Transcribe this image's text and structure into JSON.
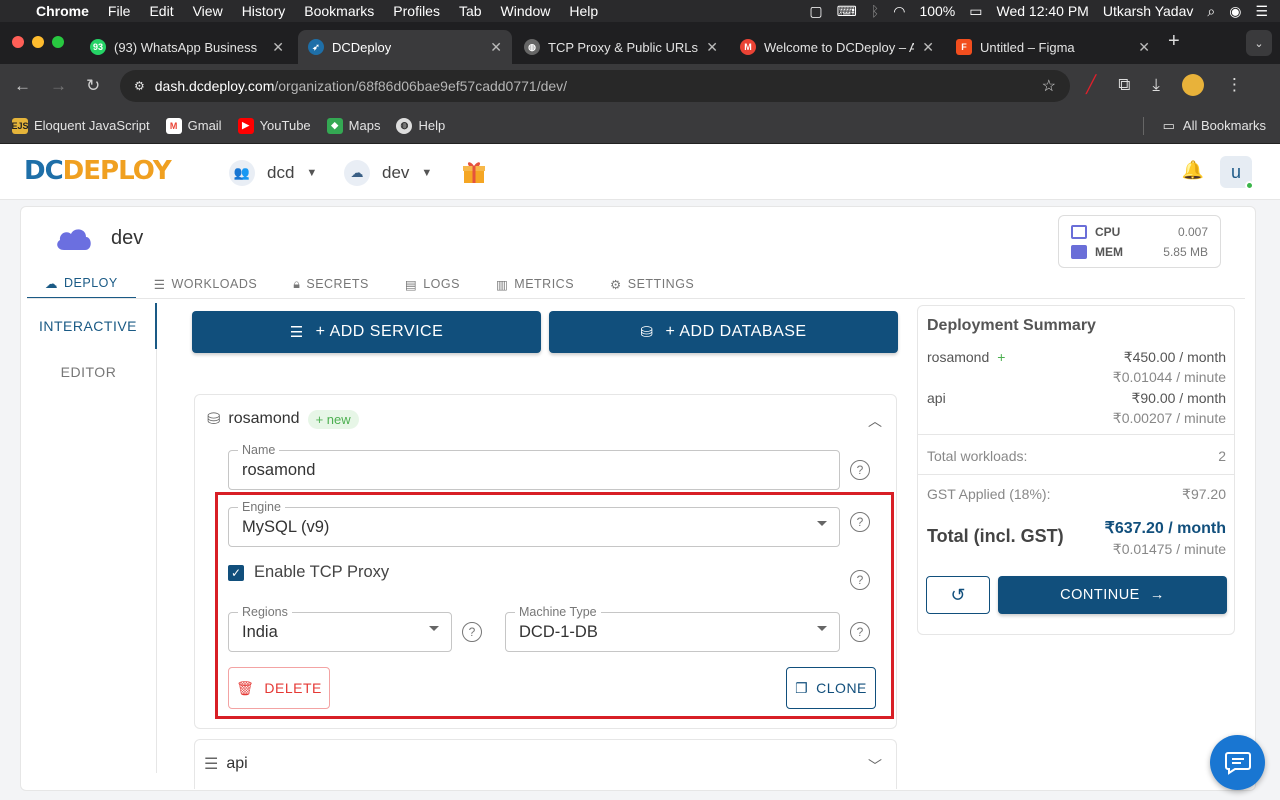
{
  "menubar": {
    "app": "Chrome",
    "items": [
      "File",
      "Edit",
      "View",
      "History",
      "Bookmarks",
      "Profiles",
      "Tab",
      "Window",
      "Help"
    ],
    "battery": "100%",
    "datetime": "Wed 12:40 PM",
    "user": "Utkarsh Yadav"
  },
  "tabs": [
    {
      "title": "(93) WhatsApp Business",
      "icon": "whatsapp-icon"
    },
    {
      "title": "DCDeploy",
      "icon": "rocket-icon"
    },
    {
      "title": "TCP Proxy & Public URLs",
      "icon": "globe-icon"
    },
    {
      "title": "Welcome to DCDeploy – A",
      "icon": "gmail-icon"
    },
    {
      "title": "Untitled – Figma",
      "icon": "figma-icon"
    }
  ],
  "address": {
    "domain": "dash.dcdeploy.com",
    "path": "/organization/68f86d06bae9ef57cadd0771/dev/"
  },
  "bookmarks": {
    "items": [
      {
        "label": "Eloquent JavaScript",
        "icon": "ejs-icon"
      },
      {
        "label": "Gmail",
        "icon": "gmail-icon"
      },
      {
        "label": "YouTube",
        "icon": "youtube-icon"
      },
      {
        "label": "Maps",
        "icon": "maps-icon"
      },
      {
        "label": "Help",
        "icon": "globe-icon"
      }
    ],
    "all": "All Bookmarks"
  },
  "header": {
    "logo_dc": "DC",
    "logo_deploy": "DEPLOY",
    "org": "dcd",
    "env": "dev",
    "user_initial": "u"
  },
  "project": {
    "name": "dev",
    "cpu_label": "CPU",
    "cpu_value": "0.007",
    "mem_label": "MEM",
    "mem_value": "5.85 MB"
  },
  "main_tabs": [
    "DEPLOY",
    "WORKLOADS",
    "SECRETS",
    "LOGS",
    "METRICS",
    "SETTINGS"
  ],
  "side_tabs": [
    "INTERACTIVE",
    "EDITOR"
  ],
  "actions": {
    "add_service": "+ ADD SERVICE",
    "add_database": "+ ADD DATABASE"
  },
  "service": {
    "name": "rosamond",
    "badge": "+ new",
    "name_label": "Name",
    "name_value": "rosamond",
    "engine_label": "Engine",
    "engine_value": "MySQL (v9)",
    "tcp_label": "Enable TCP Proxy",
    "tcp_checked": true,
    "regions_label": "Regions",
    "regions_value": "India",
    "machine_label": "Machine Type",
    "machine_value": "DCD-1-DB",
    "delete": "DELETE",
    "clone": "CLONE"
  },
  "service2": {
    "name": "api"
  },
  "summary": {
    "title": "Deployment Summary",
    "items": [
      {
        "name": "rosamond",
        "plus": "+",
        "month": "₹450.00 / month",
        "minute": "₹0.01044 / minute"
      },
      {
        "name": "api",
        "month": "₹90.00 / month",
        "minute": "₹0.00207 / minute"
      }
    ],
    "total_workloads_label": "Total workloads:",
    "total_workloads": "2",
    "gst_label": "GST Applied (18%):",
    "gst_value": "₹97.20",
    "total_label": "Total (incl. GST)",
    "total_month": "₹637.20 / month",
    "total_minute": "₹0.01475 / minute",
    "continue": "CONTINUE"
  },
  "colors": {
    "primary": "#114f7c",
    "highlight": "#d81f26",
    "danger": "#e53935",
    "success": "#4caf50"
  }
}
